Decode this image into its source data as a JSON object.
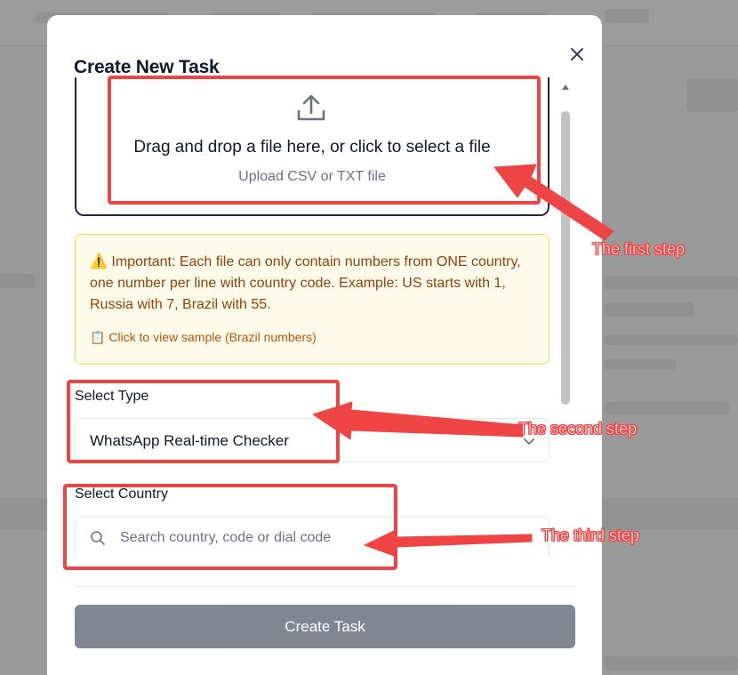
{
  "modal": {
    "title": "Create New Task",
    "dropzone": {
      "main_text": "Drag and drop a file here, or click to select a file",
      "sub_text": "Upload CSV or TXT file"
    },
    "notice": {
      "text": "⚠️ Important: Each file can only contain numbers from ONE country, one number per line with country code. Example: US starts with 1, Russia with 7, Brazil with 55.",
      "link": "📋 Click to view sample (Brazil numbers)"
    },
    "select_type": {
      "label": "Select Type",
      "value": "WhatsApp Real-time Checker"
    },
    "select_country": {
      "label": "Select Country",
      "placeholder": "Search country, code or dial code"
    },
    "create_button": "Create Task"
  },
  "annotations": {
    "step1": "The first step",
    "step2": "The second step",
    "step3": "The third step"
  },
  "colors": {
    "annotation": "#ef4444",
    "notice_bg": "#fffbeb",
    "button_bg": "#6b7280"
  },
  "icons": [
    "close-icon",
    "upload-icon",
    "chevron-down-icon",
    "search-icon"
  ]
}
